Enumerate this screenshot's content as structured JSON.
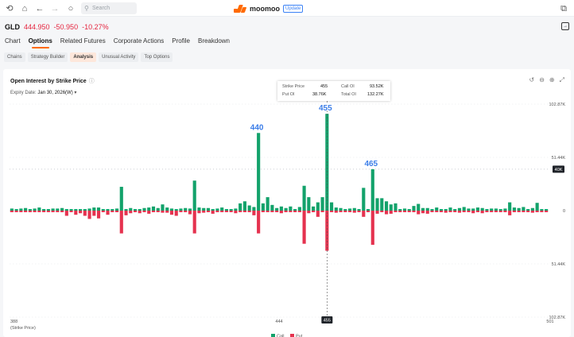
{
  "toolbar": {
    "search_placeholder": "Search"
  },
  "app": {
    "name": "moomoo",
    "update_label": "Update"
  },
  "quote": {
    "symbol": "GLD",
    "price": "444.950",
    "change": "-50.950",
    "change_pct": "-10.27%"
  },
  "tabs": [
    "Chart",
    "Options",
    "Related Futures",
    "Corporate Actions",
    "Profile",
    "Breakdown"
  ],
  "active_tab": "Options",
  "subtabs": [
    "Chains",
    "Strategy Builder",
    "Analysis",
    "Unusual Activity",
    "Top Options"
  ],
  "active_subtab": "Analysis",
  "panel": {
    "title": "Open Interest by Strike Price",
    "expiry_label": "Expiry Date:",
    "expiry_value": "Jan 30, 2026(W)"
  },
  "tooltip": {
    "strike_label": "Strike Price",
    "strike_value": "455",
    "call_label": "Call OI",
    "call_value": "93.52K",
    "put_label": "Put OI",
    "put_value": "38.76K",
    "total_label": "Total OI",
    "total_value": "132.27K"
  },
  "colors": {
    "call": "#13a26b",
    "put": "#e5324f",
    "accent": "#ff6a00",
    "label": "#3b7de8"
  },
  "chart_data": {
    "type": "bar",
    "x_first_label": "388",
    "x_mid_label": "444",
    "x_last_label": "501",
    "x_unit_label": "(Strike Price)",
    "x_cursor_label": "455",
    "y_ticks_top": [
      "102.87K",
      "51.44K"
    ],
    "y_ticks_bottom": [
      "51.44K",
      "102.87K"
    ],
    "y_zero": "0",
    "threshold_label": "40K",
    "ylim": [
      -102870,
      102870
    ],
    "legend": [
      "Call",
      "Put"
    ],
    "peak_labels": [
      {
        "strike_index": 54,
        "text": "440"
      },
      {
        "strike_index": 69,
        "text": "455"
      },
      {
        "strike_index": 79,
        "text": "465"
      }
    ],
    "call_oi": [
      2000,
      1500,
      2000,
      2500,
      1500,
      2000,
      3000,
      1500,
      1500,
      2000,
      2000,
      2500,
      1500,
      1500,
      1500,
      1500,
      1500,
      2000,
      3000,
      3000,
      1500,
      1500,
      1500,
      2000,
      23000,
      1500,
      2500,
      1500,
      1500,
      2500,
      3000,
      4000,
      2500,
      6000,
      3000,
      2000,
      1500,
      2000,
      2500,
      2000,
      29000,
      3000,
      2500,
      2500,
      1500,
      2000,
      3000,
      1500,
      1500,
      2000,
      7000,
      9000,
      5000,
      3500,
      75000,
      7000,
      13000,
      5500,
      2500,
      4000,
      2500,
      4000,
      1500,
      3500,
      24000,
      13000,
      4000,
      8000,
      13000,
      93520,
      8000,
      3000,
      2500,
      1500,
      2000,
      2500,
      1500,
      22000,
      1500,
      40000,
      12000,
      12000,
      9000,
      6000,
      7000,
      1500,
      2000,
      1500,
      4500,
      6500,
      2500,
      2500,
      1500,
      3000,
      1500,
      1500,
      3000,
      1500,
      2500,
      3500,
      2000,
      2000,
      3000,
      2500,
      1500,
      2000,
      2000,
      1500,
      2000,
      8000,
      3000,
      2500,
      3500,
      1500,
      2500,
      7500,
      1500,
      1500
    ],
    "put_oi": [
      1500,
      1500,
      1500,
      1500,
      1500,
      1500,
      1500,
      1500,
      1500,
      1500,
      1500,
      1500,
      5000,
      1500,
      4000,
      2500,
      5000,
      8000,
      5000,
      7500,
      1500,
      4000,
      1500,
      1500,
      22000,
      4500,
      2500,
      1500,
      2500,
      1500,
      3000,
      1500,
      1500,
      2000,
      2000,
      4000,
      5000,
      1500,
      1500,
      3500,
      22000,
      2500,
      2000,
      1500,
      3000,
      1500,
      1500,
      1500,
      1500,
      2500,
      1500,
      1500,
      1500,
      4500,
      22000,
      1500,
      1500,
      1500,
      1500,
      2500,
      1500,
      1500,
      1500,
      1500,
      32000,
      2500,
      1500,
      6000,
      1500,
      38760,
      1500,
      2000,
      1500,
      1500,
      1500,
      2000,
      1500,
      6000,
      1500,
      33000,
      3000,
      1500,
      3500,
      3000,
      1500,
      1500,
      1500,
      1500,
      1500,
      3500,
      2500,
      3000,
      1500,
      1500,
      1500,
      2000,
      1500,
      1500,
      2000,
      1500,
      1500,
      2500,
      1500,
      2500,
      1500,
      1500,
      1500,
      1500,
      1500,
      4500,
      1500,
      1500,
      1500,
      1500,
      2000,
      1500,
      1500,
      1500
    ]
  }
}
